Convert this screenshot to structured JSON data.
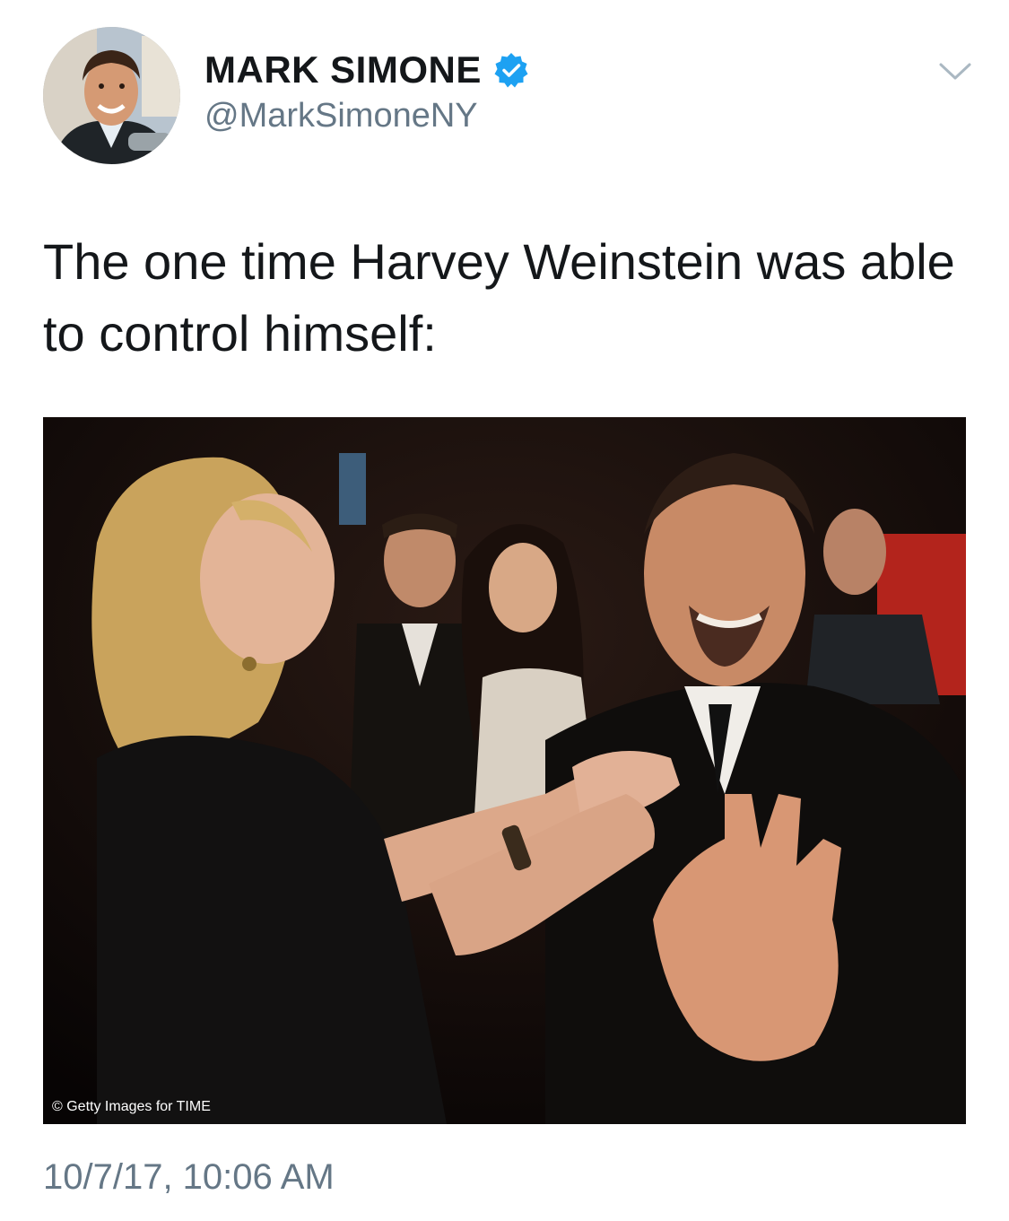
{
  "tweet": {
    "author": {
      "display_name": "MARK SIMONE",
      "handle": "@MarkSimoneNY",
      "verified": true,
      "verified_color": "#1da1f2",
      "avatar_icon": "profile-photo"
    },
    "menu_icon": "chevron-down-icon",
    "text": "The one time Harvey Weinstein was able to control himself:",
    "photo": {
      "credit": "© Getty Images for TIME"
    },
    "timestamp": "10/7/17, 10:06 AM"
  },
  "colors": {
    "text_primary": "#14171a",
    "text_secondary": "#657786",
    "verified_blue": "#1da1f2",
    "background": "#ffffff"
  }
}
